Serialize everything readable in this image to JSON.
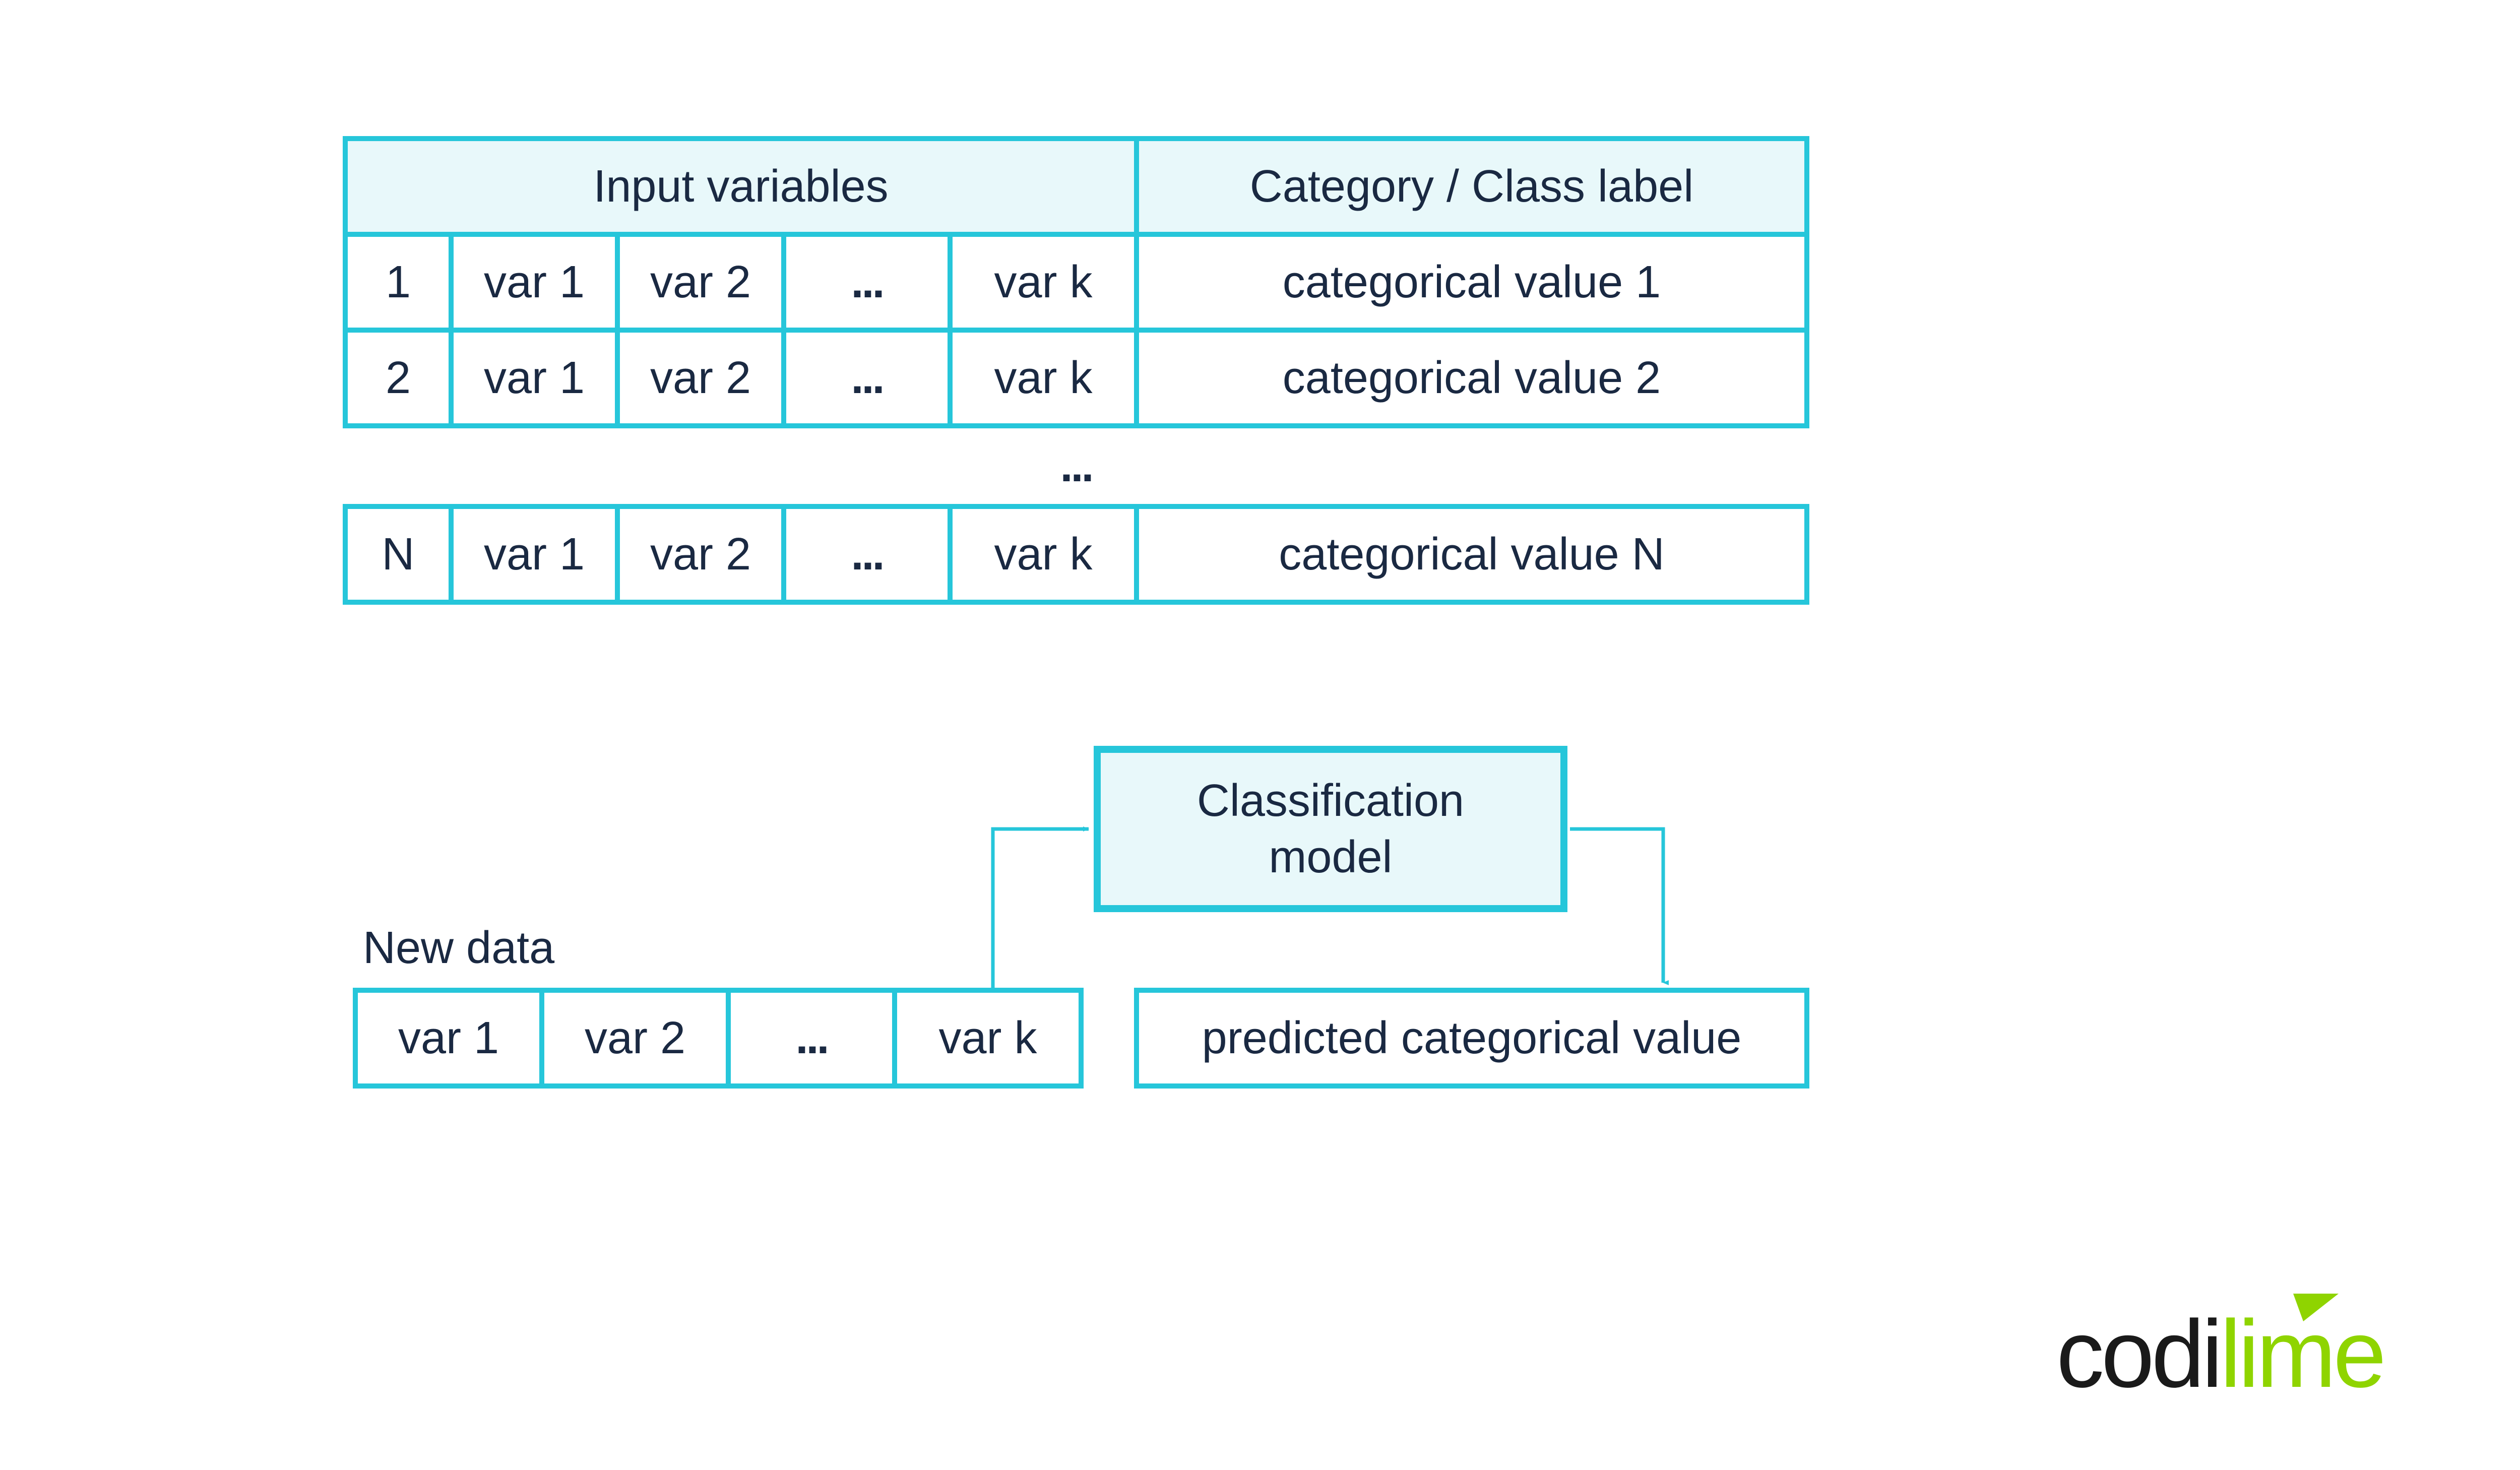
{
  "table": {
    "header_input": "Input variables",
    "header_class": "Category / Class label",
    "rows": [
      {
        "idx": "1",
        "vars": [
          "var 1",
          "var 2",
          "...",
          "var k"
        ],
        "class": "categorical value 1"
      },
      {
        "idx": "2",
        "vars": [
          "var 1",
          "var 2",
          "...",
          "var k"
        ],
        "class": "categorical value 2"
      },
      {
        "idx": "N",
        "vars": [
          "var 1",
          "var 2",
          "...",
          "var k"
        ],
        "class": "categorical value N"
      }
    ],
    "row_gap_ellipsis": "..."
  },
  "model": {
    "label_line1": "Classification",
    "label_line2": "model"
  },
  "newdata": {
    "label": "New data",
    "vars": [
      "var 1",
      "var 2",
      "...",
      "var k"
    ],
    "output": "predicted categorical value"
  },
  "brand": {
    "part1": "codi",
    "part2": "lime"
  }
}
